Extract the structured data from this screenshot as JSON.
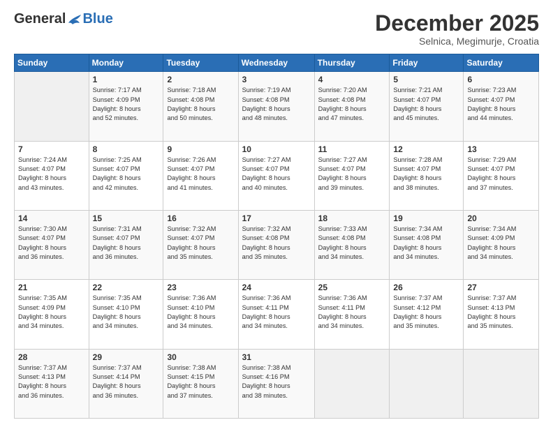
{
  "logo": {
    "general": "General",
    "blue": "Blue"
  },
  "header": {
    "month": "December 2025",
    "location": "Selnica, Megimurje, Croatia"
  },
  "days_header": [
    "Sunday",
    "Monday",
    "Tuesday",
    "Wednesday",
    "Thursday",
    "Friday",
    "Saturday"
  ],
  "weeks": [
    [
      {
        "num": "",
        "info": ""
      },
      {
        "num": "1",
        "info": "Sunrise: 7:17 AM\nSunset: 4:09 PM\nDaylight: 8 hours\nand 52 minutes."
      },
      {
        "num": "2",
        "info": "Sunrise: 7:18 AM\nSunset: 4:08 PM\nDaylight: 8 hours\nand 50 minutes."
      },
      {
        "num": "3",
        "info": "Sunrise: 7:19 AM\nSunset: 4:08 PM\nDaylight: 8 hours\nand 48 minutes."
      },
      {
        "num": "4",
        "info": "Sunrise: 7:20 AM\nSunset: 4:08 PM\nDaylight: 8 hours\nand 47 minutes."
      },
      {
        "num": "5",
        "info": "Sunrise: 7:21 AM\nSunset: 4:07 PM\nDaylight: 8 hours\nand 45 minutes."
      },
      {
        "num": "6",
        "info": "Sunrise: 7:23 AM\nSunset: 4:07 PM\nDaylight: 8 hours\nand 44 minutes."
      }
    ],
    [
      {
        "num": "7",
        "info": "Sunrise: 7:24 AM\nSunset: 4:07 PM\nDaylight: 8 hours\nand 43 minutes."
      },
      {
        "num": "8",
        "info": "Sunrise: 7:25 AM\nSunset: 4:07 PM\nDaylight: 8 hours\nand 42 minutes."
      },
      {
        "num": "9",
        "info": "Sunrise: 7:26 AM\nSunset: 4:07 PM\nDaylight: 8 hours\nand 41 minutes."
      },
      {
        "num": "10",
        "info": "Sunrise: 7:27 AM\nSunset: 4:07 PM\nDaylight: 8 hours\nand 40 minutes."
      },
      {
        "num": "11",
        "info": "Sunrise: 7:27 AM\nSunset: 4:07 PM\nDaylight: 8 hours\nand 39 minutes."
      },
      {
        "num": "12",
        "info": "Sunrise: 7:28 AM\nSunset: 4:07 PM\nDaylight: 8 hours\nand 38 minutes."
      },
      {
        "num": "13",
        "info": "Sunrise: 7:29 AM\nSunset: 4:07 PM\nDaylight: 8 hours\nand 37 minutes."
      }
    ],
    [
      {
        "num": "14",
        "info": "Sunrise: 7:30 AM\nSunset: 4:07 PM\nDaylight: 8 hours\nand 36 minutes."
      },
      {
        "num": "15",
        "info": "Sunrise: 7:31 AM\nSunset: 4:07 PM\nDaylight: 8 hours\nand 36 minutes."
      },
      {
        "num": "16",
        "info": "Sunrise: 7:32 AM\nSunset: 4:07 PM\nDaylight: 8 hours\nand 35 minutes."
      },
      {
        "num": "17",
        "info": "Sunrise: 7:32 AM\nSunset: 4:08 PM\nDaylight: 8 hours\nand 35 minutes."
      },
      {
        "num": "18",
        "info": "Sunrise: 7:33 AM\nSunset: 4:08 PM\nDaylight: 8 hours\nand 34 minutes."
      },
      {
        "num": "19",
        "info": "Sunrise: 7:34 AM\nSunset: 4:08 PM\nDaylight: 8 hours\nand 34 minutes."
      },
      {
        "num": "20",
        "info": "Sunrise: 7:34 AM\nSunset: 4:09 PM\nDaylight: 8 hours\nand 34 minutes."
      }
    ],
    [
      {
        "num": "21",
        "info": "Sunrise: 7:35 AM\nSunset: 4:09 PM\nDaylight: 8 hours\nand 34 minutes."
      },
      {
        "num": "22",
        "info": "Sunrise: 7:35 AM\nSunset: 4:10 PM\nDaylight: 8 hours\nand 34 minutes."
      },
      {
        "num": "23",
        "info": "Sunrise: 7:36 AM\nSunset: 4:10 PM\nDaylight: 8 hours\nand 34 minutes."
      },
      {
        "num": "24",
        "info": "Sunrise: 7:36 AM\nSunset: 4:11 PM\nDaylight: 8 hours\nand 34 minutes."
      },
      {
        "num": "25",
        "info": "Sunrise: 7:36 AM\nSunset: 4:11 PM\nDaylight: 8 hours\nand 34 minutes."
      },
      {
        "num": "26",
        "info": "Sunrise: 7:37 AM\nSunset: 4:12 PM\nDaylight: 8 hours\nand 35 minutes."
      },
      {
        "num": "27",
        "info": "Sunrise: 7:37 AM\nSunset: 4:13 PM\nDaylight: 8 hours\nand 35 minutes."
      }
    ],
    [
      {
        "num": "28",
        "info": "Sunrise: 7:37 AM\nSunset: 4:13 PM\nDaylight: 8 hours\nand 36 minutes."
      },
      {
        "num": "29",
        "info": "Sunrise: 7:37 AM\nSunset: 4:14 PM\nDaylight: 8 hours\nand 36 minutes."
      },
      {
        "num": "30",
        "info": "Sunrise: 7:38 AM\nSunset: 4:15 PM\nDaylight: 8 hours\nand 37 minutes."
      },
      {
        "num": "31",
        "info": "Sunrise: 7:38 AM\nSunset: 4:16 PM\nDaylight: 8 hours\nand 38 minutes."
      },
      {
        "num": "",
        "info": ""
      },
      {
        "num": "",
        "info": ""
      },
      {
        "num": "",
        "info": ""
      }
    ]
  ]
}
